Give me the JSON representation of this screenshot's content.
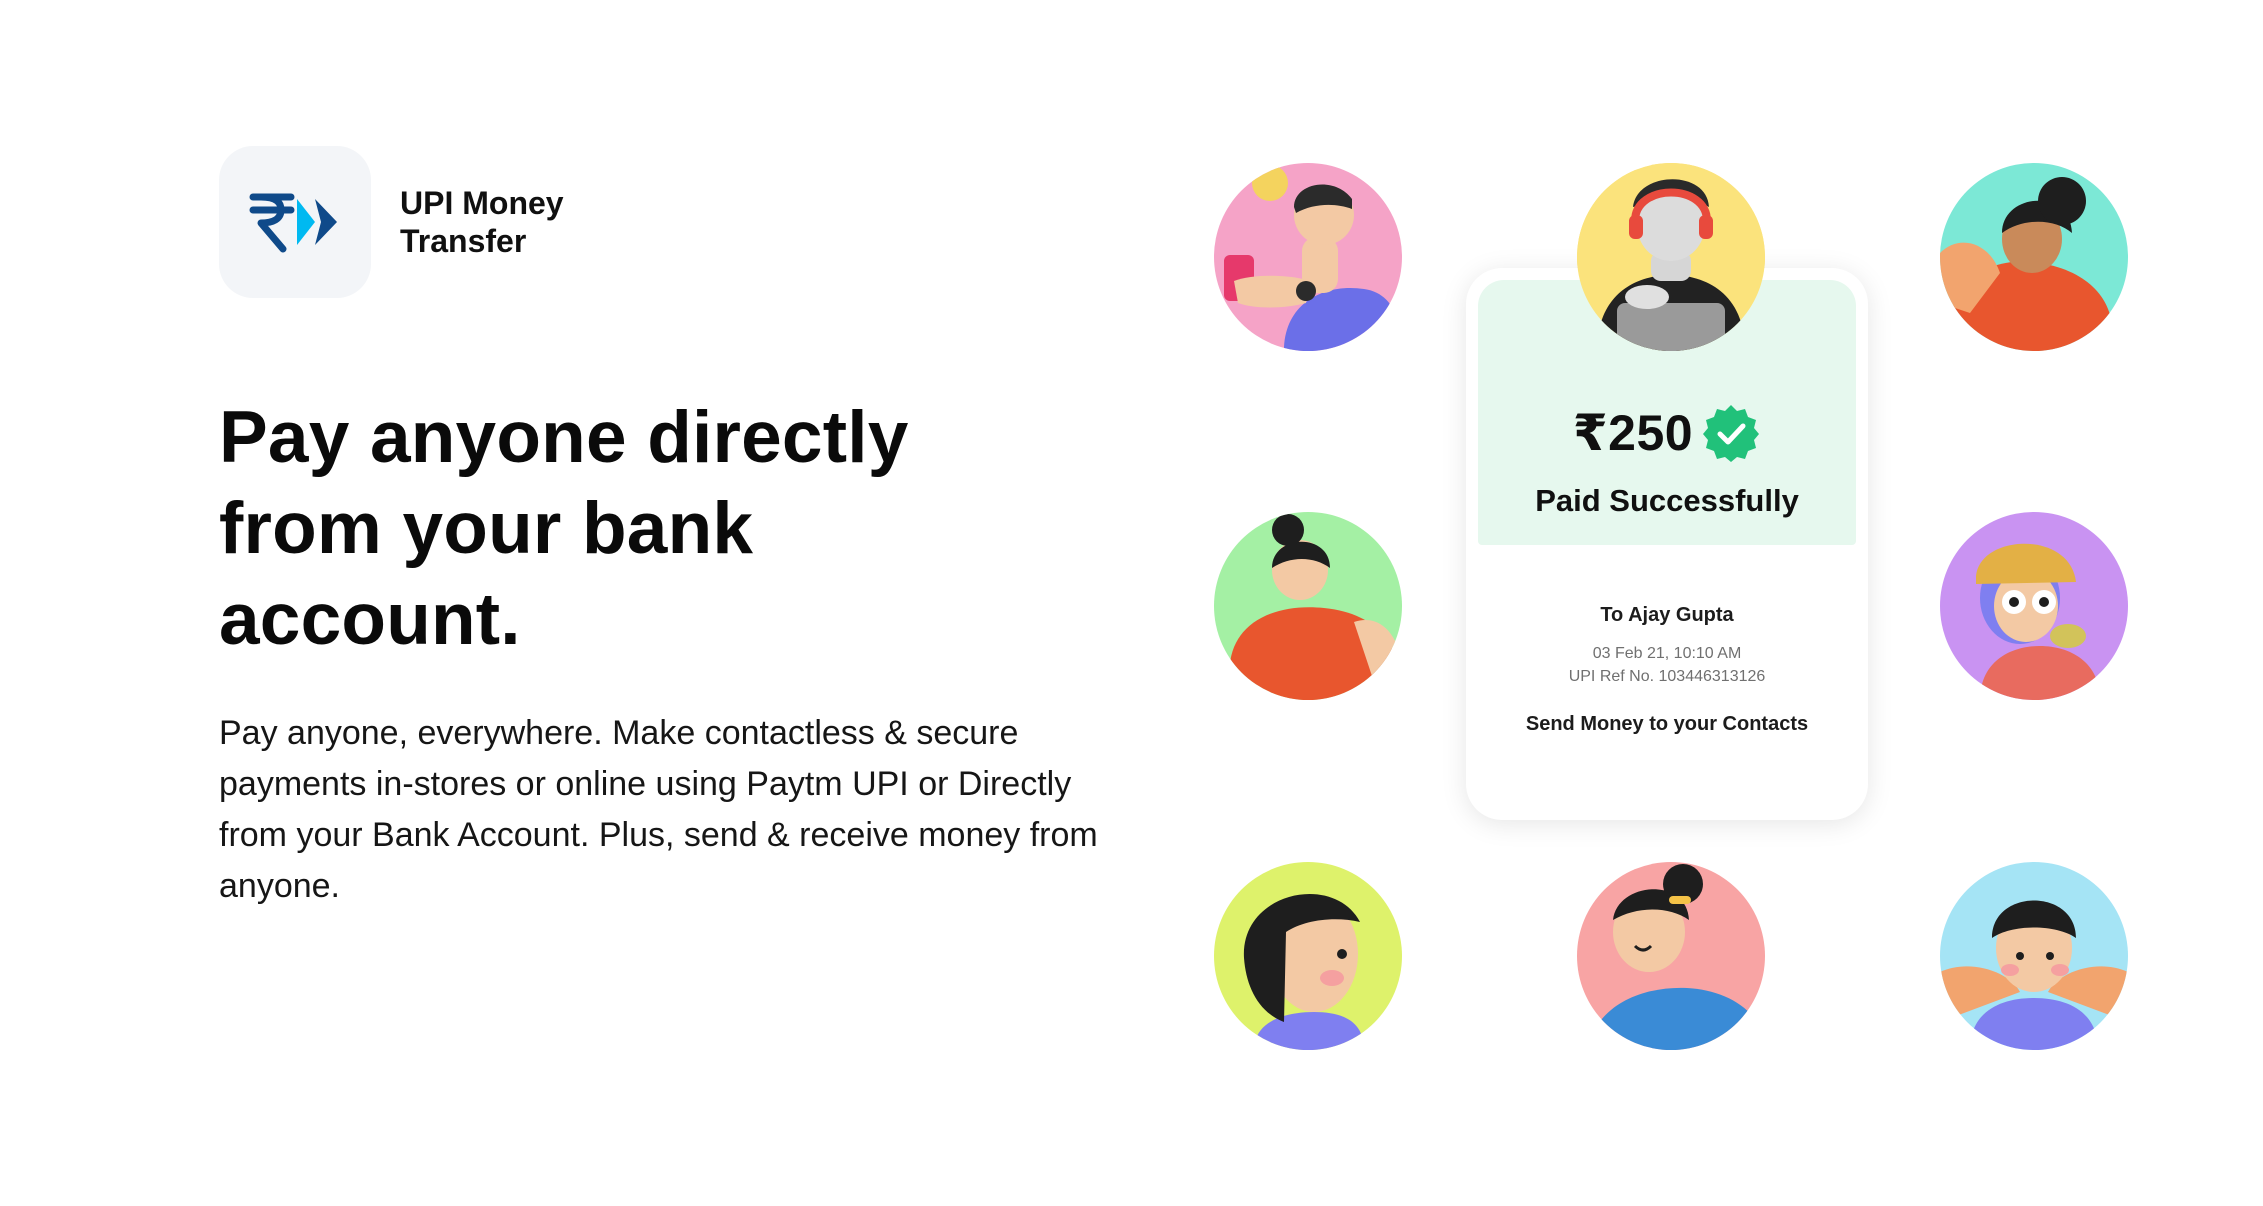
{
  "brand": {
    "logo_icon": "rupee-arrow-logo-icon",
    "name": "UPI Money Transfer"
  },
  "hero": {
    "headline": "Pay anyone directly from your bank account.",
    "description": "Pay anyone, everywhere. Make contactless & secure payments in-stores or online using Paytm UPI or Directly from your Bank Account. Plus, send & receive money from anyone."
  },
  "payment_card": {
    "amount": "₹250",
    "status_icon": "verified-check-icon",
    "status": "Paid Successfully",
    "recipient": "To Ajay Gupta",
    "date": "03 Feb 21, 10:10 AM",
    "reference": "UPI Ref No. 103446313126",
    "action": "Send Money to your Contacts"
  },
  "colors": {
    "accent_blue": "#0f4a8a",
    "accent_cyan": "#00b9f1",
    "success_green": "#21c17a",
    "card_top_bg": "#e6f8ee",
    "avatar_backgrounds": [
      "#f5a3c7",
      "#fbe37c",
      "#7ce8d6",
      "#a4f0a4",
      "#c993f2",
      "#def26b",
      "#f8a4a4",
      "#a5e4f5"
    ]
  }
}
